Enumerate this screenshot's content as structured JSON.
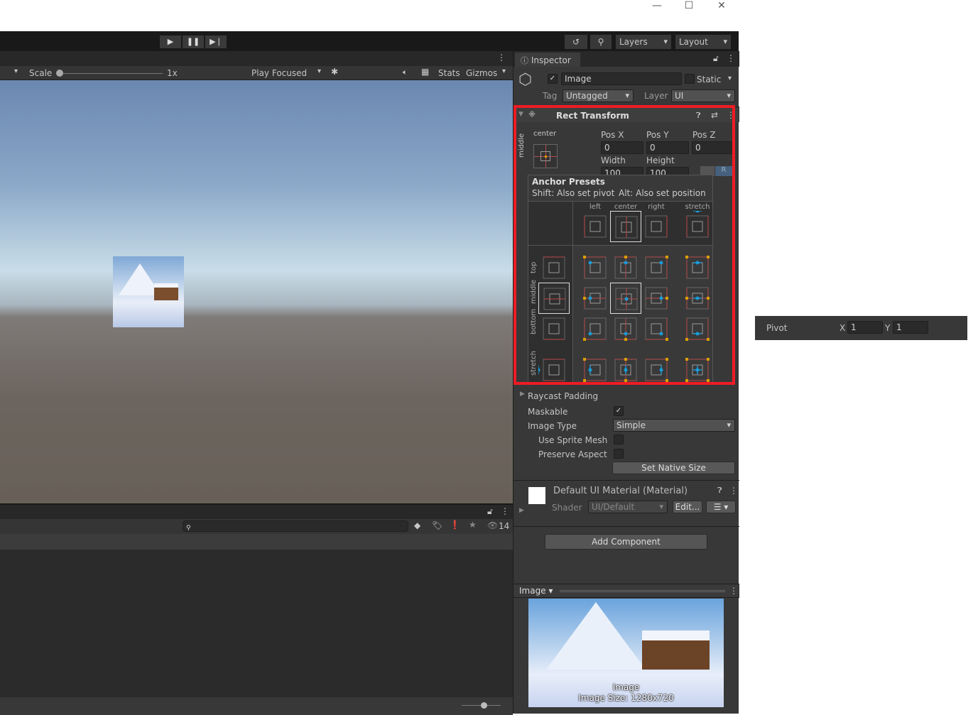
{
  "window": {
    "minimize": "—",
    "maximize": "☐",
    "close": "✕"
  },
  "toolbar": {
    "layers": "Layers",
    "layout": "Layout",
    "play_icon": "play-icon",
    "pause_icon": "pause-icon",
    "step_icon": "step-icon"
  },
  "game": {
    "scale_label": "Scale",
    "scale_value": "1x",
    "play_mode": "Play Focused",
    "stats": "Stats",
    "gizmos": "Gizmos"
  },
  "project": {
    "search_placeholder": "",
    "hidden_count": "14"
  },
  "inspector": {
    "tab": "Inspector",
    "object_name": "Image",
    "active": true,
    "static_label": "Static",
    "tag_label": "Tag",
    "tag_value": "Untagged",
    "layer_label": "Layer",
    "layer_value": "UI",
    "rect_transform": {
      "title": "Rect Transform",
      "anchor_h": "center",
      "anchor_v": "middle",
      "pos_x_label": "Pos X",
      "pos_y_label": "Pos Y",
      "pos_z_label": "Pos Z",
      "pos_x": "0",
      "pos_y": "0",
      "pos_z": "0",
      "width_label": "Width",
      "height_label": "Height",
      "width": "100",
      "height": "100",
      "r_button": "R"
    },
    "anchor_presets": {
      "title": "Anchor Presets",
      "hint_shift": "Shift: Also set pivot",
      "hint_alt": "Alt: Also set position",
      "columns": [
        "left",
        "center",
        "right",
        "stretch"
      ],
      "rows": [
        "top",
        "middle",
        "bottom",
        "stretch"
      ],
      "selected": "middle-center"
    },
    "image": {
      "raycast_padding": "Raycast Padding",
      "maskable_label": "Maskable",
      "maskable": true,
      "image_type_label": "Image Type",
      "image_type": "Simple",
      "use_sprite_mesh": "Use Sprite Mesh",
      "preserve_aspect": "Preserve Aspect",
      "set_native_size": "Set Native Size"
    },
    "material": {
      "name": "Default UI Material (Material)",
      "shader_label": "Shader",
      "shader": "UI/Default",
      "edit": "Edit..."
    },
    "add_component": "Add Component",
    "preview": {
      "title": "Image",
      "caption_name": "Image",
      "caption_size": "Image Size: 1280x720"
    }
  },
  "pivot_panel": {
    "label": "Pivot",
    "x_label": "X",
    "x": "1",
    "y_label": "Y",
    "y": "1"
  },
  "colors": {
    "accent_red": "#ee1c25",
    "anchor_blue": "#1a9bd7",
    "anchor_red": "#b84a4a",
    "anchor_orange": "#d9a000"
  }
}
